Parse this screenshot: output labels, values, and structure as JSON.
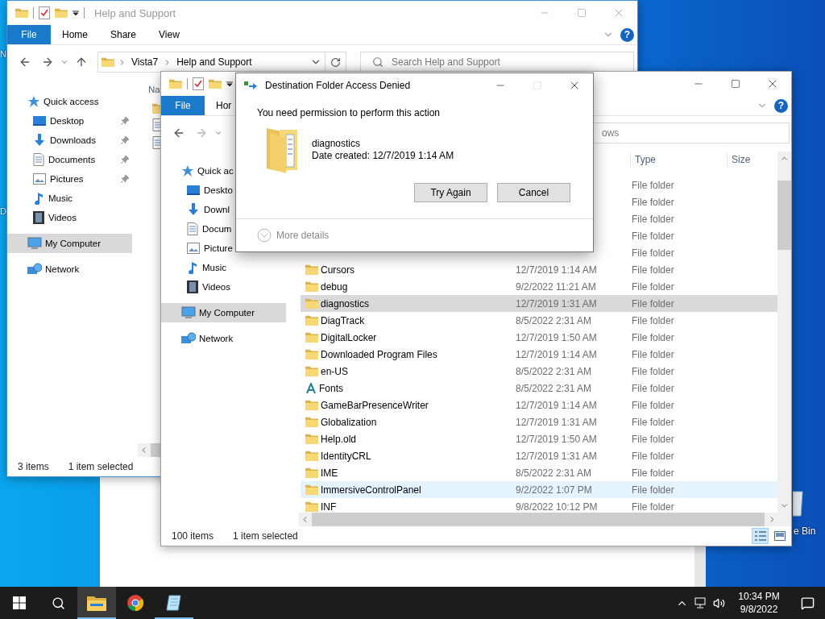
{
  "desktop": {
    "edge_labels": [
      "N",
      "D"
    ],
    "recycle_bin_label": "e Bin"
  },
  "window_back": {
    "active": false,
    "title": "Help and Support",
    "ribbon_tabs": [
      {
        "label": "File",
        "kind": "file"
      },
      {
        "label": "Home",
        "kind": "tab"
      },
      {
        "label": "Share",
        "kind": "tab"
      },
      {
        "label": "View",
        "kind": "tab"
      }
    ],
    "help_glyph": "?",
    "address": [
      "Vista7",
      "Help and Support"
    ],
    "search": {
      "placeholder": "Search Help and Support"
    },
    "nav": [
      {
        "label": "Quick access",
        "kind": "star",
        "selected": false,
        "children": [
          {
            "label": "Desktop",
            "kind": "desktop",
            "pinned": true,
            "selected": false
          },
          {
            "label": "Downloads",
            "kind": "downloads",
            "pinned": true,
            "selected": false
          },
          {
            "label": "Documents",
            "kind": "documents",
            "pinned": true,
            "selected": false
          },
          {
            "label": "Pictures",
            "kind": "pictures",
            "pinned": true,
            "selected": false
          },
          {
            "label": "Music",
            "kind": "music",
            "pinned": false,
            "selected": false
          },
          {
            "label": "Videos",
            "kind": "videos",
            "pinned": false,
            "selected": false
          }
        ]
      },
      {
        "label": "My Computer",
        "kind": "computer",
        "selected": true
      },
      {
        "label": "Network",
        "kind": "network",
        "selected": false
      }
    ],
    "column_1": "Na",
    "status": {
      "count": "3 items",
      "selection": "1 item selected"
    }
  },
  "window_front": {
    "active": true,
    "ribbon_tabs": [
      {
        "label": "File",
        "kind": "file"
      },
      {
        "label": "Hor",
        "kind": "tab"
      }
    ],
    "help_glyph": "?",
    "search": {
      "placeholder": "ows"
    },
    "nav": [
      {
        "label": "Quick ac",
        "kind": "star",
        "selected": false,
        "children": [
          {
            "label": "Deskto",
            "kind": "desktop",
            "selected": false
          },
          {
            "label": "Downl",
            "kind": "downloads",
            "selected": false
          },
          {
            "label": "Docum",
            "kind": "documents",
            "selected": false
          },
          {
            "label": "Picture",
            "kind": "pictures",
            "selected": false
          },
          {
            "label": "Music",
            "kind": "music",
            "selected": false
          },
          {
            "label": "Videos",
            "kind": "videos",
            "selected": false
          }
        ]
      },
      {
        "label": "My Computer",
        "kind": "computer",
        "selected": true
      },
      {
        "label": "Network",
        "kind": "network",
        "selected": false
      }
    ],
    "columns": [
      "Type",
      "Size"
    ],
    "rows": [
      {
        "type": "File folder",
        "selected": false,
        "hovered": false
      },
      {
        "type": "File folder",
        "selected": false,
        "hovered": false
      },
      {
        "type": "File folder",
        "selected": false,
        "hovered": false
      },
      {
        "type": "File folder",
        "selected": false,
        "hovered": false
      },
      {
        "type": "File folder",
        "selected": false,
        "hovered": false
      },
      {
        "name": "Cursors",
        "date": "12/7/2019 1:14 AM",
        "type": "File folder",
        "kind": "folder",
        "selected": false,
        "hovered": false
      },
      {
        "name": "debug",
        "date": "9/2/2022 11:21 AM",
        "type": "File folder",
        "kind": "folder",
        "selected": false,
        "hovered": false
      },
      {
        "name": "diagnostics",
        "date": "12/7/2019 1:31 AM",
        "type": "File folder",
        "kind": "folder",
        "selected": true,
        "hovered": false
      },
      {
        "name": "DiagTrack",
        "date": "8/5/2022 2:31 AM",
        "type": "File folder",
        "kind": "folder",
        "selected": false,
        "hovered": false
      },
      {
        "name": "DigitalLocker",
        "date": "12/7/2019 1:50 AM",
        "type": "File folder",
        "kind": "folder",
        "selected": false,
        "hovered": false
      },
      {
        "name": "Downloaded Program Files",
        "date": "12/7/2019 1:14 AM",
        "type": "File folder",
        "kind": "folder",
        "selected": false,
        "hovered": false
      },
      {
        "name": "en-US",
        "date": "8/5/2022 2:31 AM",
        "type": "File folder",
        "kind": "folder",
        "selected": false,
        "hovered": false
      },
      {
        "name": "Fonts",
        "date": "8/5/2022 2:31 AM",
        "type": "File folder",
        "kind": "fonts",
        "selected": false,
        "hovered": false
      },
      {
        "name": "GameBarPresenceWriter",
        "date": "12/7/2019 1:14 AM",
        "type": "File folder",
        "kind": "folder",
        "selected": false,
        "hovered": false
      },
      {
        "name": "Globalization",
        "date": "12/7/2019 1:31 AM",
        "type": "File folder",
        "kind": "folder",
        "selected": false,
        "hovered": false
      },
      {
        "name": "Help.old",
        "date": "12/7/2019 1:50 AM",
        "type": "File folder",
        "kind": "folder",
        "selected": false,
        "hovered": false
      },
      {
        "name": "IdentityCRL",
        "date": "12/7/2019 1:31 AM",
        "type": "File folder",
        "kind": "folder",
        "selected": false,
        "hovered": false
      },
      {
        "name": "IME",
        "date": "8/5/2022 2:31 AM",
        "type": "File folder",
        "kind": "folder",
        "selected": false,
        "hovered": false
      },
      {
        "name": "ImmersiveControlPanel",
        "date": "9/2/2022 1:07 PM",
        "type": "File folder",
        "kind": "folder",
        "selected": false,
        "hovered": true
      },
      {
        "name": "INF",
        "date": "9/8/2022 10:12 PM",
        "type": "File folder",
        "kind": "folder",
        "selected": false,
        "hovered": false
      }
    ],
    "status": {
      "count": "100 items",
      "selection": "1 item selected"
    }
  },
  "dialog": {
    "title": "Destination Folder Access Denied",
    "message": "You need permission to perform this action",
    "file": {
      "name": "diagnostics",
      "detail": "Date created: 12/7/2019 1:14 AM"
    },
    "buttons": [
      "Try Again",
      "Cancel"
    ],
    "more_details": "More details"
  },
  "taskbar": {
    "apps": [
      {
        "kind": "explorer",
        "active": true,
        "open": true
      },
      {
        "kind": "chrome",
        "active": false,
        "open": false
      },
      {
        "kind": "notepad",
        "active": false,
        "open": true
      }
    ],
    "clock": {
      "time": "10:34 PM",
      "date": "9/8/2022"
    }
  }
}
